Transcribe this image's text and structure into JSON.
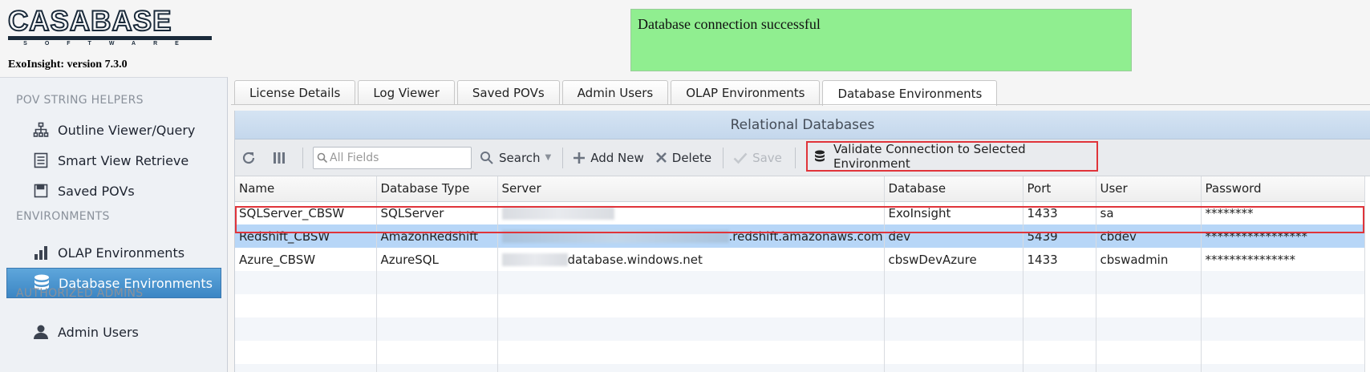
{
  "header": {
    "logo_text": "CASABASE",
    "logo_sub": "SOFTWARE",
    "version": "ExoInsight: version 7.3.0",
    "message": "Database connection successful"
  },
  "sidebar": {
    "sections": [
      {
        "title": "POV STRING HELPERS"
      },
      {
        "title": "ENVIRONMENTS"
      },
      {
        "title": "AUTHORIZED ADMINS"
      }
    ],
    "items": [
      {
        "label": "Outline Viewer/Query",
        "icon": "hierarchy-icon"
      },
      {
        "label": "Smart View Retrieve",
        "icon": "document-icon"
      },
      {
        "label": "Saved POVs",
        "icon": "save-icon"
      },
      {
        "label": "OLAP Environments",
        "icon": "bar-chart-icon"
      },
      {
        "label": "Database Environments",
        "icon": "database-icon"
      },
      {
        "label": "Admin Users",
        "icon": "user-icon"
      }
    ]
  },
  "tabs": [
    {
      "label": "License Details"
    },
    {
      "label": "Log Viewer"
    },
    {
      "label": "Saved POVs"
    },
    {
      "label": "Admin Users"
    },
    {
      "label": "OLAP Environments"
    },
    {
      "label": "Database Environments"
    }
  ],
  "panel": {
    "title": "Relational Databases",
    "search_placeholder": "All Fields",
    "search_label": "Search",
    "add_label": "Add New",
    "delete_label": "Delete",
    "save_label": "Save",
    "validate_label": "Validate Connection to Selected Environment"
  },
  "grid": {
    "columns": [
      "Name",
      "Database Type",
      "Server",
      "Database",
      "Port",
      "User",
      "Password"
    ],
    "rows": [
      {
        "name": "SQLServer_CBSW",
        "type": "SQLServer",
        "server": "",
        "database": "ExoInsight",
        "port": "1433",
        "user": "sa",
        "password": "********"
      },
      {
        "name": "Redshift_CBSW",
        "type": "AmazonRedshift",
        "server": ".redshift.amazonaws.com",
        "database": "dev",
        "port": "5439",
        "user": "cbdev",
        "password": "*****************"
      },
      {
        "name": "Azure_CBSW",
        "type": "AzureSQL",
        "server": "database.windows.net",
        "database": "cbswDevAzure",
        "port": "1433",
        "user": "cbswadmin",
        "password": "***************"
      }
    ]
  },
  "colors": {
    "message_bg": "#90ee90",
    "active_nav": "#4a90d0",
    "highlight": "#e0343a",
    "selected_row": "#b7d6f7"
  }
}
